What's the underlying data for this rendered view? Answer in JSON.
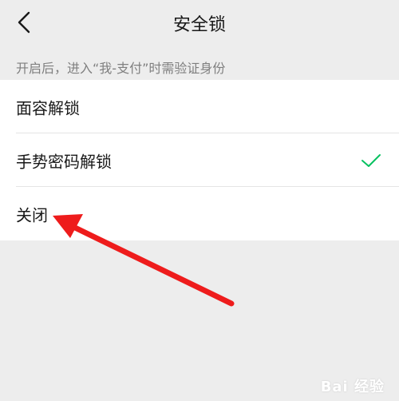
{
  "header": {
    "title": "安全锁",
    "back_icon": "chevron-left-icon"
  },
  "hint": "开启后，进入“我-支付”时需验证身份",
  "options": [
    {
      "label": "面容解锁",
      "selected": false
    },
    {
      "label": "手势密码解锁",
      "selected": true
    },
    {
      "label": "关闭",
      "selected": false
    }
  ],
  "annotation": {
    "arrow_color": "#ee1c1c",
    "target": "关闭"
  },
  "watermark": "Bai 经验",
  "colors": {
    "background": "#ededed",
    "check": "#07c160",
    "arrow": "#ee1c1c"
  }
}
